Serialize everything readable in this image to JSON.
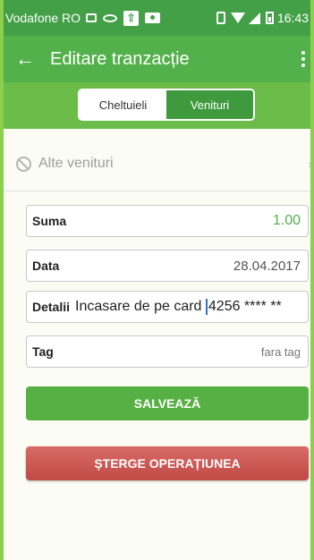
{
  "status_bar": {
    "carrier": "Vodafone RO",
    "time": "16:43"
  },
  "app_bar": {
    "title": "Editare tranzacție"
  },
  "tabs": [
    {
      "label": "Cheltuieli",
      "active": true
    },
    {
      "label": "Venituri",
      "active": false
    }
  ],
  "category": {
    "label": "Alte venituri"
  },
  "form": {
    "sum": {
      "label": "Suma",
      "value": "1.00"
    },
    "date": {
      "label": "Data",
      "value": "28.04.2017"
    },
    "details": {
      "label": "Detalii",
      "value_before_cursor": "Incasare de pe card ",
      "value_after_cursor": "4256 **** **"
    },
    "tag": {
      "label": "Tag",
      "value": "fara tag"
    }
  },
  "buttons": {
    "save_label": "SALVEAZĂ",
    "delete_label": "ȘTERGE OPERAȚIUNEA"
  },
  "colors": {
    "status_bar": "#43a047",
    "app_bar": "#52b14a",
    "tab_bar": "#6cbc4a",
    "save_button": "#57b043",
    "delete_button": "#c9544f",
    "sum_value": "#52b14a"
  }
}
